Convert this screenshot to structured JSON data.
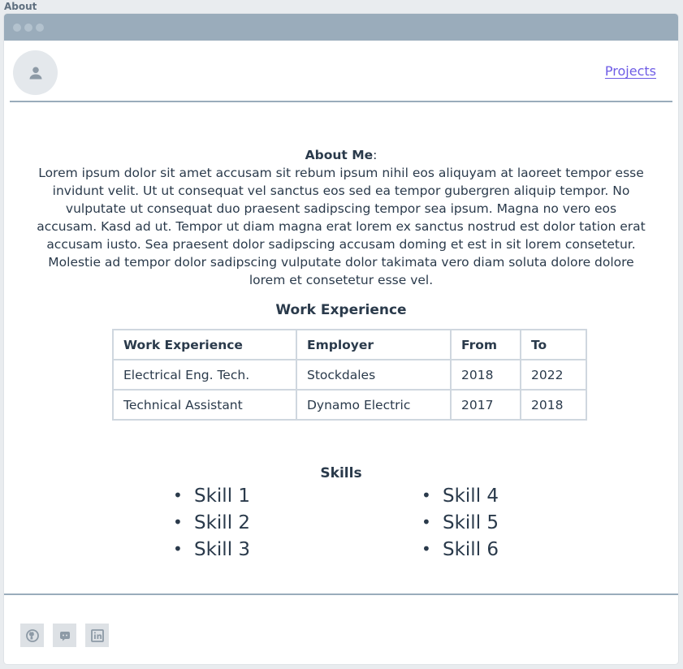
{
  "frame": {
    "title": "About"
  },
  "nav": {
    "projects_label": "Projects"
  },
  "about": {
    "label": "About Me",
    "text": "Lorem ipsum dolor sit amet accusam sit rebum ipsum nihil eos aliquyam at laoreet tempor esse invidunt velit. Ut ut consequat vel sanctus eos sed ea tempor gubergren aliquip tempor. No vulputate ut consequat duo praesent sadipscing tempor sea ipsum. Magna no vero eos accusam. Kasd ad ut. Tempor ut diam magna erat lorem ex sanctus nostrud est dolor tation erat accusam iusto. Sea praesent dolor sadipscing accusam doming et est in sit lorem consetetur. Molestie ad tempor dolor sadipscing vulputate dolor takimata vero diam soluta dolore dolore lorem et consetetur esse vel."
  },
  "work": {
    "title": "Work Experience",
    "headers": [
      "Work Experience",
      "Employer",
      "From",
      "To"
    ],
    "rows": [
      [
        "Electrical Eng. Tech.",
        "Stockdales",
        "2018",
        "2022"
      ],
      [
        "Technical Assistant",
        "Dynamo Electric",
        "2017",
        "2018"
      ]
    ]
  },
  "skills": {
    "title": "Skills",
    "items": [
      "Skill 1",
      "Skill 2",
      "Skill 3",
      "Skill 4",
      "Skill 5",
      "Skill 6"
    ]
  },
  "footer": {
    "icons": [
      "github-icon",
      "discord-icon",
      "linkedin-icon"
    ]
  },
  "colors": {
    "accent_link": "#6e5ce6",
    "rule": "#9aacbb",
    "titlebar": "#9aacbb"
  }
}
